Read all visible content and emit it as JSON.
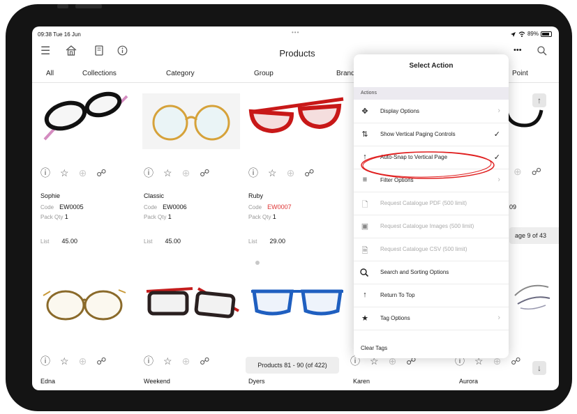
{
  "status": {
    "time": "09:38  Tue 16 Jun",
    "dots": "•••",
    "battery": "89%"
  },
  "nav": {
    "title": "Products",
    "more": "•••"
  },
  "tabs": [
    "All",
    "Collections",
    "Category",
    "Group",
    "Brand",
    "Point"
  ],
  "products_row1": [
    {
      "name": "Sophie",
      "code_label": "Code",
      "code": "EW0005",
      "pack_label": "Pack Qty",
      "pack": "1",
      "list_label": "List",
      "price": "45.00",
      "code_color": "#111111"
    },
    {
      "name": "Classic",
      "code_label": "Code",
      "code": "EW0006",
      "pack_label": "Pack Qty",
      "pack": "1",
      "list_label": "List",
      "price": "45.00",
      "code_color": "#111111"
    },
    {
      "name": "Ruby",
      "code_label": "Code",
      "code": "EW0007",
      "pack_label": "Pack Qty",
      "pack": "1",
      "list_label": "List",
      "price": "29.00",
      "code_color": "#dd3333"
    }
  ],
  "partial_code": "09",
  "products_row2": [
    "Edna",
    "Weekend",
    "Dyers",
    "Karen",
    "Aurora"
  ],
  "pagination": {
    "products": "Products 81 - 90 (of 422)",
    "page": "age 9 of 43"
  },
  "menu": {
    "title": "Select Action",
    "section": "Actions",
    "items": [
      {
        "label": "Display Options",
        "icon": "move-arrows-icon",
        "trail": "chevron",
        "disabled": false
      },
      {
        "label": "Show Vertical Paging Controls",
        "icon": "vertical-swap-icon",
        "trail": "check",
        "disabled": false
      },
      {
        "label": "Auto-Snap to Vertical Page",
        "icon": "snap-arrow-icon",
        "trail": "check",
        "disabled": false
      },
      {
        "label": "Filter Options",
        "icon": "filter-lines-icon",
        "trail": "chevron",
        "disabled": false
      },
      {
        "label": "Request Catalogue PDF (500 limit)",
        "icon": "document-icon",
        "trail": "",
        "disabled": true
      },
      {
        "label": "Request Catalogue Images (500 limit)",
        "icon": "images-icon",
        "trail": "",
        "disabled": true
      },
      {
        "label": "Request Catalogue CSV (500 limit)",
        "icon": "csv-document-icon",
        "trail": "",
        "disabled": true
      },
      {
        "label": "Search and Sorting Options",
        "icon": "search-icon",
        "trail": "",
        "disabled": false
      },
      {
        "label": "Return To Top",
        "icon": "arrow-up-icon",
        "trail": "",
        "disabled": false
      },
      {
        "label": "Tag Options",
        "icon": "star-filled-icon",
        "trail": "chevron",
        "disabled": false
      }
    ],
    "clear_tags": "Clear Tags"
  },
  "colors": {
    "accent_annotation": "#e02020",
    "menu_header_bg": "#eceaf0"
  }
}
